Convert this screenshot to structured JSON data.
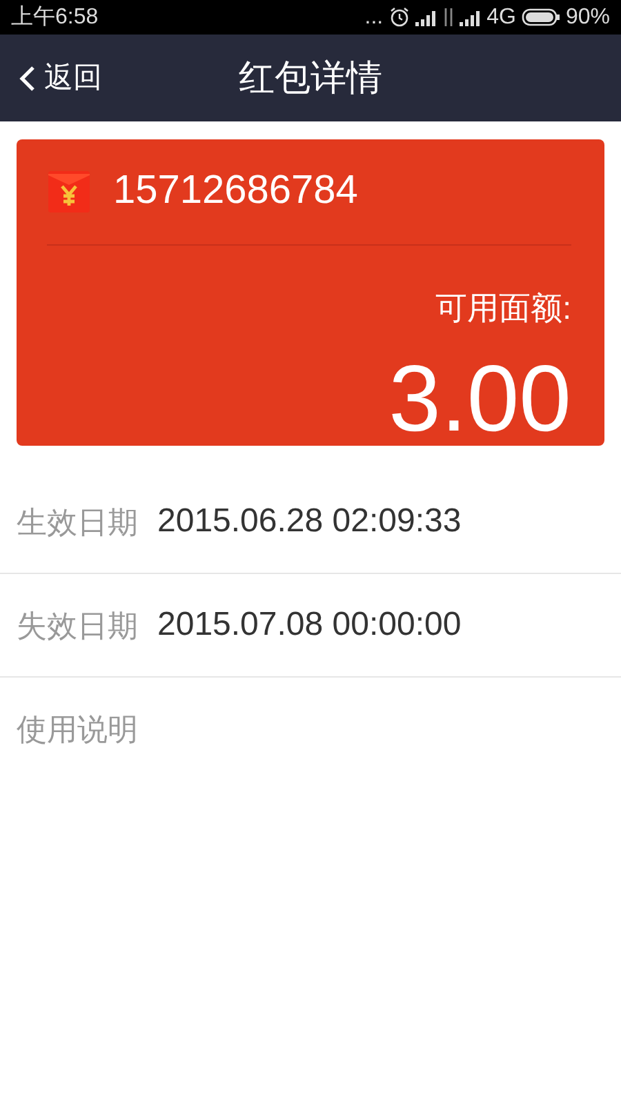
{
  "status_bar": {
    "time": "上午6:58",
    "more": "...",
    "network": "4G",
    "battery": "90%"
  },
  "nav": {
    "back": "返回",
    "title": "红包详情"
  },
  "card": {
    "phone": "15712686784",
    "amount_label": "可用面额:",
    "amount": "3.00"
  },
  "details": [
    {
      "label": "生效日期",
      "value": "2015.06.28 02:09:33"
    },
    {
      "label": "失效日期",
      "value": "2015.07.08 00:00:00"
    },
    {
      "label": "使用说明"
    }
  ]
}
